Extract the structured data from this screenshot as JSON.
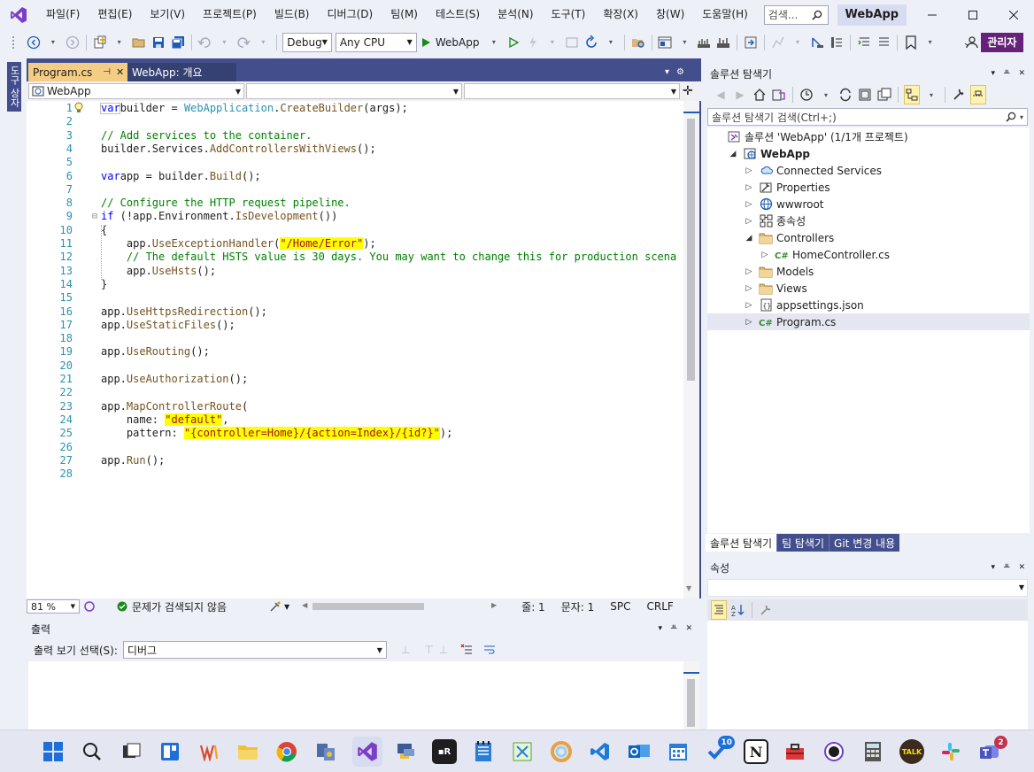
{
  "titlebar": {
    "menus": [
      "파일(F)",
      "편집(E)",
      "보기(V)",
      "프로젝트(P)",
      "빌드(B)",
      "디버그(D)",
      "팀(M)",
      "테스트(S)",
      "분석(N)",
      "도구(T)",
      "확장(X)",
      "창(W)",
      "도움말(H)"
    ],
    "search_placeholder": "검색...",
    "app_name": "WebApp"
  },
  "toolbar": {
    "config": "Debug",
    "platform": "Any CPU",
    "run_target": "WebApp",
    "admin_label": "관리자"
  },
  "left_strip": {
    "tab_label": "도구 상자"
  },
  "editor": {
    "tabs": [
      {
        "label": "Program.cs",
        "pin": "⊣"
      },
      {
        "label": "WebApp: 개요"
      }
    ],
    "nav_project": "WebApp",
    "lines": [
      {
        "n": "1",
        "tokens": [
          [
            "kw",
            "var"
          ],
          [
            "",
            "builder = "
          ],
          [
            "ty",
            "WebApplication"
          ],
          [
            "",
            "."
          ],
          [
            "me",
            "CreateBuilder"
          ],
          [
            "",
            "(args);"
          ]
        ]
      },
      {
        "n": "2",
        "tokens": []
      },
      {
        "n": "3",
        "tokens": [
          [
            "cm",
            "// Add services to the container."
          ]
        ]
      },
      {
        "n": "4",
        "tokens": [
          [
            "",
            "builder.Services."
          ],
          [
            "me",
            "AddControllersWithViews"
          ],
          [
            "",
            "();"
          ]
        ]
      },
      {
        "n": "5",
        "tokens": []
      },
      {
        "n": "6",
        "tokens": [
          [
            "kw",
            "var"
          ],
          [
            "",
            "app = builder."
          ],
          [
            "me",
            "Build"
          ],
          [
            "",
            "();"
          ]
        ]
      },
      {
        "n": "7",
        "tokens": []
      },
      {
        "n": "8",
        "tokens": [
          [
            "cm",
            "// Configure the HTTP request pipeline."
          ]
        ]
      },
      {
        "n": "9",
        "tokens": [
          [
            "kw",
            "if"
          ],
          [
            "",
            " (!app.Environment."
          ],
          [
            "me",
            "IsDevelopment"
          ],
          [
            "",
            "())"
          ]
        ]
      },
      {
        "n": "10",
        "tokens": [
          [
            "",
            "{"
          ]
        ]
      },
      {
        "n": "11",
        "tokens": [
          [
            "",
            "    app."
          ],
          [
            "me",
            "UseExceptionHandler"
          ],
          [
            "",
            "("
          ],
          [
            "st",
            "\"/Home/Error\""
          ],
          [
            "",
            ");"
          ]
        ]
      },
      {
        "n": "12",
        "tokens": [
          [
            "cm",
            "    // The default HSTS value is 30 days. You may want to change this for production scena"
          ]
        ]
      },
      {
        "n": "13",
        "tokens": [
          [
            "",
            "    app."
          ],
          [
            "me",
            "UseHsts"
          ],
          [
            "",
            "();"
          ]
        ]
      },
      {
        "n": "14",
        "tokens": [
          [
            "",
            "}"
          ]
        ]
      },
      {
        "n": "15",
        "tokens": []
      },
      {
        "n": "16",
        "tokens": [
          [
            "",
            "app."
          ],
          [
            "me",
            "UseHttpsRedirection"
          ],
          [
            "",
            "();"
          ]
        ]
      },
      {
        "n": "17",
        "tokens": [
          [
            "",
            "app."
          ],
          [
            "me",
            "UseStaticFiles"
          ],
          [
            "",
            "();"
          ]
        ]
      },
      {
        "n": "18",
        "tokens": []
      },
      {
        "n": "19",
        "tokens": [
          [
            "",
            "app."
          ],
          [
            "me",
            "UseRouting"
          ],
          [
            "",
            "();"
          ]
        ]
      },
      {
        "n": "20",
        "tokens": []
      },
      {
        "n": "21",
        "tokens": [
          [
            "",
            "app."
          ],
          [
            "me",
            "UseAuthorization"
          ],
          [
            "",
            "();"
          ]
        ]
      },
      {
        "n": "22",
        "tokens": []
      },
      {
        "n": "23",
        "tokens": [
          [
            "",
            "app."
          ],
          [
            "me",
            "MapControllerRoute"
          ],
          [
            "",
            "("
          ]
        ]
      },
      {
        "n": "24",
        "tokens": [
          [
            "",
            "    name: "
          ],
          [
            "st",
            "\"default\""
          ],
          [
            "",
            ","
          ]
        ]
      },
      {
        "n": "25",
        "tokens": [
          [
            "",
            "    pattern: "
          ],
          [
            "st",
            "\"{controller=Home}/{action=Index}/{id?}\""
          ],
          [
            "",
            ");"
          ]
        ]
      },
      {
        "n": "26",
        "tokens": []
      },
      {
        "n": "27",
        "tokens": [
          [
            "",
            "app."
          ],
          [
            "me",
            "Run"
          ],
          [
            "",
            "();"
          ]
        ]
      },
      {
        "n": "28",
        "tokens": []
      }
    ],
    "status": {
      "zoom": "81 %",
      "issues": "문제가 검색되지 않음",
      "line": "줄: 1",
      "col": "문자: 1",
      "spc": "SPC",
      "eol": "CRLF"
    }
  },
  "output": {
    "title": "출력",
    "source_label": "출력 보기 선택(S):",
    "source_value": "디버그"
  },
  "solution_explorer": {
    "title": "솔루션 탐색기",
    "search_placeholder": "솔루션 탐색기 검색(Ctrl+;)",
    "tree": [
      {
        "label": "솔루션 'WebApp' (1/1개 프로젝트)",
        "depth": 0,
        "arrow": "",
        "icon": "solution-icon"
      },
      {
        "label": "WebApp",
        "depth": 1,
        "arrow": "◢",
        "icon": "web-project-icon",
        "bold": true
      },
      {
        "label": "Connected Services",
        "depth": 2,
        "arrow": "▷",
        "icon": "connected-services-icon"
      },
      {
        "label": "Properties",
        "depth": 2,
        "arrow": "▷",
        "icon": "properties-icon"
      },
      {
        "label": "wwwroot",
        "depth": 2,
        "arrow": "▷",
        "icon": "globe-icon"
      },
      {
        "label": "종속성",
        "depth": 2,
        "arrow": "▷",
        "icon": "dependencies-icon"
      },
      {
        "label": "Controllers",
        "depth": 2,
        "arrow": "◢",
        "icon": "folder-icon"
      },
      {
        "label": "HomeController.cs",
        "depth": 3,
        "arrow": "▷",
        "icon": "csharp-file-icon"
      },
      {
        "label": "Models",
        "depth": 2,
        "arrow": "▷",
        "icon": "folder-icon"
      },
      {
        "label": "Views",
        "depth": 2,
        "arrow": "▷",
        "icon": "folder-icon"
      },
      {
        "label": "appsettings.json",
        "depth": 2,
        "arrow": "▷",
        "icon": "json-file-icon"
      },
      {
        "label": "Program.cs",
        "depth": 2,
        "arrow": "▷",
        "icon": "csharp-file-icon",
        "selected": true
      }
    ],
    "tabs": [
      "솔루션 탐색기",
      "팀 탐색기",
      "Git 변경 내용"
    ]
  },
  "properties": {
    "title": "속성"
  },
  "taskbar": {
    "badges": {
      "todo": "10",
      "teams": "2"
    },
    "kakao_label": "TALK",
    "notion_label": "N"
  },
  "colors": {
    "accent": "#68217a",
    "frame_blue": "#424f8c",
    "tab_yellow": "#f5cc84",
    "selection": "#e4e6f1"
  }
}
